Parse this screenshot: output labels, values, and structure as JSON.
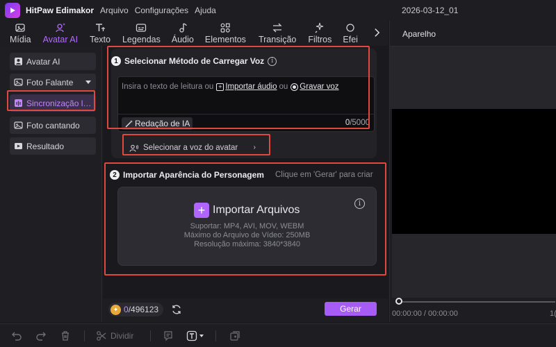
{
  "titlebar": {
    "app_name": "HitPaw Edimakor",
    "menu": [
      "Arquivo",
      "Configurações",
      "Ajuda"
    ],
    "project_name": "2026-03-12_01"
  },
  "tabs": [
    {
      "label": "Mídia",
      "icon": "media-icon"
    },
    {
      "label": "Avatar AI",
      "icon": "avatar-ai-icon",
      "active": true
    },
    {
      "label": "Texto",
      "icon": "text-icon"
    },
    {
      "label": "Legendas",
      "icon": "subtitles-icon"
    },
    {
      "label": "Áudio",
      "icon": "audio-icon"
    },
    {
      "label": "Elementos",
      "icon": "elements-icon"
    },
    {
      "label": "Transição",
      "icon": "transition-icon"
    },
    {
      "label": "Filtros",
      "icon": "filters-icon"
    },
    {
      "label": "Efei",
      "icon": "effects-icon"
    }
  ],
  "sidebar": {
    "items": [
      {
        "label": "Avatar AI",
        "icon": "avatar-icon"
      },
      {
        "label": "Foto Falante",
        "icon": "photo-talk-icon",
        "has_dropdown": true
      },
      {
        "label": "Sincronização labial",
        "icon": "lip-sync-icon",
        "active": true
      },
      {
        "label": "Foto cantando",
        "icon": "photo-sing-icon"
      },
      {
        "label": "Resultado",
        "icon": "result-icon"
      }
    ]
  },
  "step1": {
    "number": "1",
    "title": "Selecionar Método de Carregar Voz",
    "placeholder_prefix": "Insira o texto de leitura ou",
    "import_audio": "Importar áudio",
    "or": "ou",
    "record_voice": "Gravar voz",
    "ai_writing": "Redação de IA",
    "char_count": "0",
    "char_limit": "/5000",
    "select_voice": "Selecionar a voz do avatar"
  },
  "step2": {
    "number": "2",
    "title": "Importar Aparência do Personagem",
    "hint": "Clique em 'Gerar' para criar",
    "import_files": "Importar Arquivos",
    "support": "Suportar: MP4, AVI, MOV, WEBM",
    "max_size": "Máximo do Arquivo de Vídeo: 250MB",
    "max_resolution": "Resolução máxima: 3840*3840"
  },
  "footer": {
    "credits_current": "0",
    "credits_total": "/496123",
    "generate": "Gerar"
  },
  "preview": {
    "title": "Aparelho",
    "time": "00:00:00 / 00:00:00",
    "time_right": "1("
  },
  "bottombar": {
    "split_label": "Dividir"
  },
  "colors": {
    "accent": "#a85cf6",
    "highlight": "#e0493e",
    "background": "#1b1b1f"
  }
}
